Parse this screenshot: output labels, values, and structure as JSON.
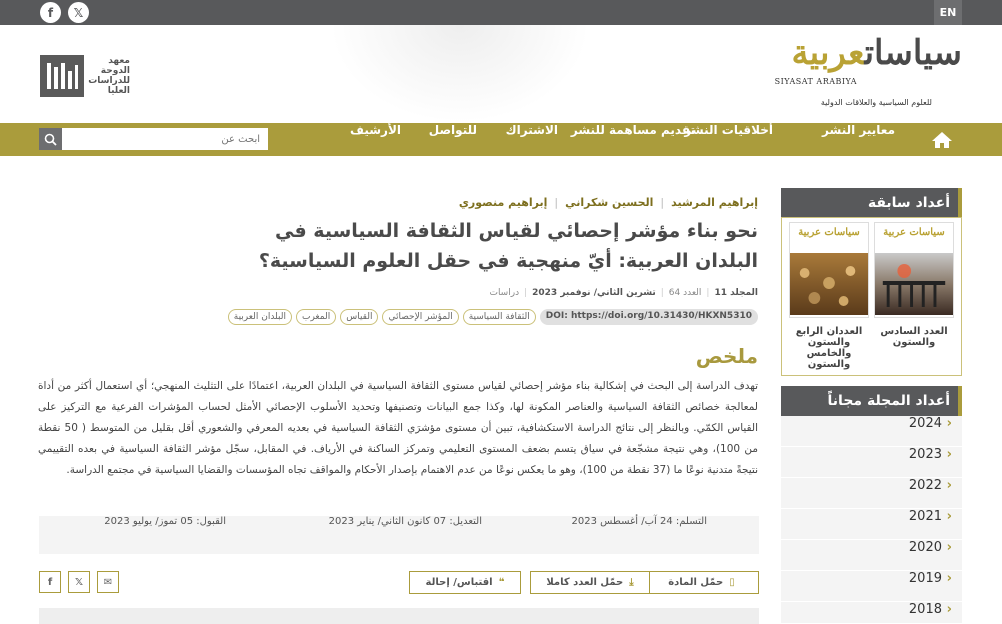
{
  "topbar": {
    "facebook_icon": "f",
    "x_icon": "𝕏",
    "lang_button": "EN"
  },
  "header": {
    "logo_ar_part1": "سياسات",
    "logo_ar_part2": "عربية",
    "logo_en": "SIYASAT ARABIYA",
    "logo_tagline": "للعلوم السياسية والعلاقات الدولية",
    "institute_text": "معهد الدوحة للدراسات العليا"
  },
  "nav": {
    "items": [
      "معايير النشر",
      "أخلاقيات النشر",
      "تقديم مساهمة للنشر",
      "الاشتراك",
      "للتواصل",
      "الأرشيف"
    ],
    "search_placeholder": "ابحث عن"
  },
  "article": {
    "authors": [
      "إبراهيم المرشيد",
      "الحسين شكراني",
      "إبراهيم منصوري"
    ],
    "title": "نحو بناء مؤشر إحصائي لقياس الثقافة السياسية في البلدان العربية: أيّ منهجية في حقل العلوم السياسية؟",
    "meta": {
      "volume": "المجلد 11",
      "issue": "العدد 64",
      "date": "تشرين الثاني/ نوفمبر 2023",
      "type": "دراسات"
    },
    "doi": "DOI: https://doi.org/10.31430/HKXN5310",
    "tags": [
      "الثقافة السياسية",
      "المؤشر الإحصائي",
      "القياس",
      "المغرب",
      "البلدان العربية"
    ],
    "abstract_title": "ملخص",
    "abstract_text": "تهدف الدراسة إلى البحث في إشكالية بناء مؤشر إحصائي لقياس مستوى الثقافة السياسية في البلدان العربية، اعتمادًا على التثليث المنهجي؛ أي استعمال أكثر من أداة لمعالجة خصائص الثقافة السياسية والعناصر المكونة لها، وكذا جمع البيانات وتصنيفها وتحديد الأسلوب الإحصائي الأمثل لحساب المؤشرات الفرعية مع التركيز على القياس الكمّي. وبالنظر إلى نتائج الدراسة الاستكشافية، تبين أن مستوى مؤشرَي الثقافة السياسية في بعديه المعرفي والشعوري أقل بقليل من المتوسط ( 50 نقطة من 100)، وهي نتيجة مشجّعة في سياق يتسم بضعف المستوى التعليمي وتمركز الساكنة في الأرياف. في المقابل، سجّل مؤشر الثقافة السياسية في بعده التقييمي نتيجةً متدنية نوعًا ما (37 نقطة من 100)، وهو ما يعكس نوعًا من عدم الاهتمام بإصدار الأحكام والمواقف تجاه المؤسسات والقضايا السياسية في مجتمع الدراسة.",
    "dates": {
      "received": "التسلم: 24 آب/ أغسطس 2023",
      "revised": "التعديل: 07 كانون الثاني/ يناير 2023",
      "accepted": "القبول: 05 تموز/ يوليو 2023"
    },
    "actions": {
      "download_article": "حمّل المادة",
      "download_issue": "حمّل العدد كاملا",
      "cite": "اقتباس/ إحالة"
    },
    "share": {
      "email_icon": "✉",
      "x_icon": "𝕏",
      "facebook_icon": "f"
    }
  },
  "sidebar": {
    "previous_title": "أعداد سابقة",
    "covers_title": "سياسات عربية",
    "previous_issues": [
      {
        "label": "العدد السادس والستون"
      },
      {
        "label": "العددان الرابع والستون والخامس والستون"
      }
    ],
    "free_title": "أعداد المجلة مجاناً",
    "years": [
      "2024",
      "2023",
      "2022",
      "2021",
      "2020",
      "2019",
      "2018"
    ]
  },
  "colors": {
    "accent": "#aa9c3c",
    "dark": "#58595b",
    "gold": "#b9a234"
  }
}
